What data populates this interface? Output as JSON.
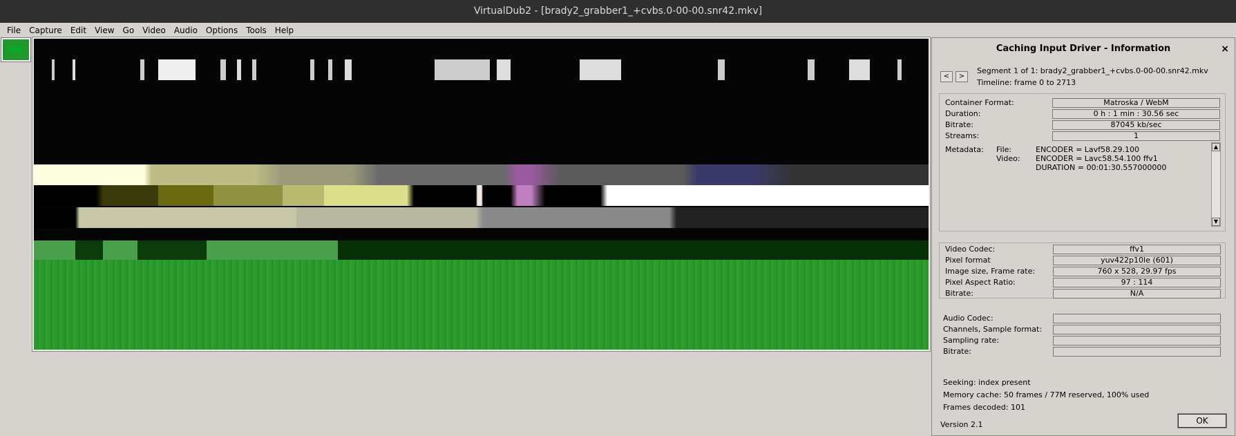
{
  "window": {
    "title": "VirtualDub2  - [brady2_grabber1_+cvbs.0-00-00.snr42.mkv]"
  },
  "menu": [
    "File",
    "Capture",
    "Edit",
    "View",
    "Go",
    "Video",
    "Audio",
    "Options",
    "Tools",
    "Help"
  ],
  "dialog": {
    "title": "Caching Input Driver - Information",
    "close_symbol": "×",
    "segment": "Segment 1 of 1: brady2_grabber1_+cvbs.0-00-00.snr42.mkv",
    "timeline": "Timeline: frame 0 to 2713",
    "prev_symbol": "<",
    "next_symbol": ">",
    "container": {
      "format_label": "Container Format:",
      "format": "Matroska / WebM",
      "duration_label": "Duration:",
      "duration": "0 h : 1 min : 30.56 sec",
      "bitrate_label": "Bitrate:",
      "bitrate": "87045 kb/sec",
      "streams_label": "Streams:",
      "streams": "1"
    },
    "metadata": {
      "label": "Metadata:",
      "file_label": "File:",
      "video_label": "Video:",
      "file_value": "ENCODER = Lavf58.29.100",
      "video_lines": [
        "ENCODER = Lavc58.54.100 ffv1",
        "DURATION = 00:01:30.557000000"
      ]
    },
    "video": {
      "codec_label": "Video Codec:",
      "codec": "ffv1",
      "pixfmt_label": "Pixel format",
      "pixfmt": "yuv422p10le (601)",
      "size_label": "Image size, Frame rate:",
      "size": "760 x 528, 29.97 fps",
      "par_label": "Pixel Aspect Ratio:",
      "par": "97 : 114",
      "bitrate_label": "Bitrate:",
      "bitrate": "N/A"
    },
    "audio": {
      "codec_label": "Audio Codec:",
      "codec": "",
      "channels_label": "Channels, Sample format:",
      "channels": "",
      "rate_label": "Sampling rate:",
      "rate": "",
      "bitrate_label": "Bitrate:",
      "bitrate": ""
    },
    "seeking": "Seeking: index present",
    "memory_cache": "Memory cache: 50 frames / 77M reserved, 100% used",
    "frames_decoded": "Frames decoded: 101",
    "version": "Version 2.1",
    "ok_label": "OK"
  }
}
